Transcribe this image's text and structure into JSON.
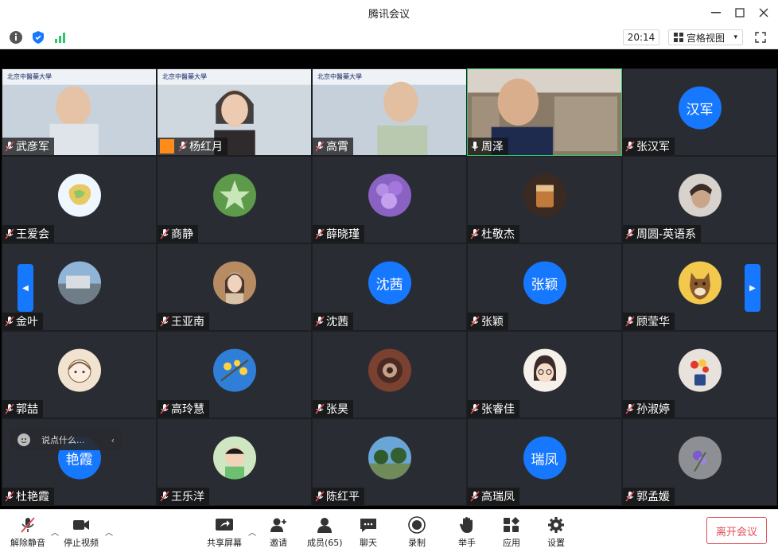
{
  "window": {
    "title": "腾讯会议"
  },
  "toolbar": {
    "timer": "20:14",
    "view_label": "宫格视图"
  },
  "colors": {
    "accent": "#1677ff",
    "leave": "#e0505a",
    "tile_bg": "#2a2c33",
    "active_border": "#2ec66a"
  },
  "participants": [
    {
      "name": "武彦军"
    },
    {
      "name": "杨红月"
    },
    {
      "name": "高霄"
    },
    {
      "name": "周泽"
    },
    {
      "name": "张汉军",
      "avatar_text": "汉军"
    },
    {
      "name": "王爱会"
    },
    {
      "name": "商静"
    },
    {
      "name": "薛晓瑾"
    },
    {
      "name": "杜敬杰"
    },
    {
      "name": "周圆-英语系"
    },
    {
      "name": "金叶"
    },
    {
      "name": "王亚南"
    },
    {
      "name": "沈茜",
      "avatar_text": "沈茜"
    },
    {
      "name": "张颖",
      "avatar_text": "张颖"
    },
    {
      "name": "顾莹华"
    },
    {
      "name": "郭喆"
    },
    {
      "name": "高玲慧"
    },
    {
      "name": "张昊"
    },
    {
      "name": "张睿佳"
    },
    {
      "name": "孙淑婷"
    },
    {
      "name": "杜艳霞",
      "avatar_text": "艳霞"
    },
    {
      "name": "王乐洋"
    },
    {
      "name": "陈红平"
    },
    {
      "name": "高瑞凤",
      "avatar_text": "瑞凤"
    },
    {
      "name": "郭孟媛"
    }
  ],
  "chat": {
    "placeholder": "说点什么..."
  },
  "bottom": {
    "unmute": "解除静音",
    "stop_video": "停止视频",
    "share": "共享屏幕",
    "invite": "邀请",
    "members": "成员(65)",
    "chat": "聊天",
    "record": "录制",
    "raise_hand": "举手",
    "apps": "应用",
    "settings": "设置",
    "leave": "离开会议"
  }
}
